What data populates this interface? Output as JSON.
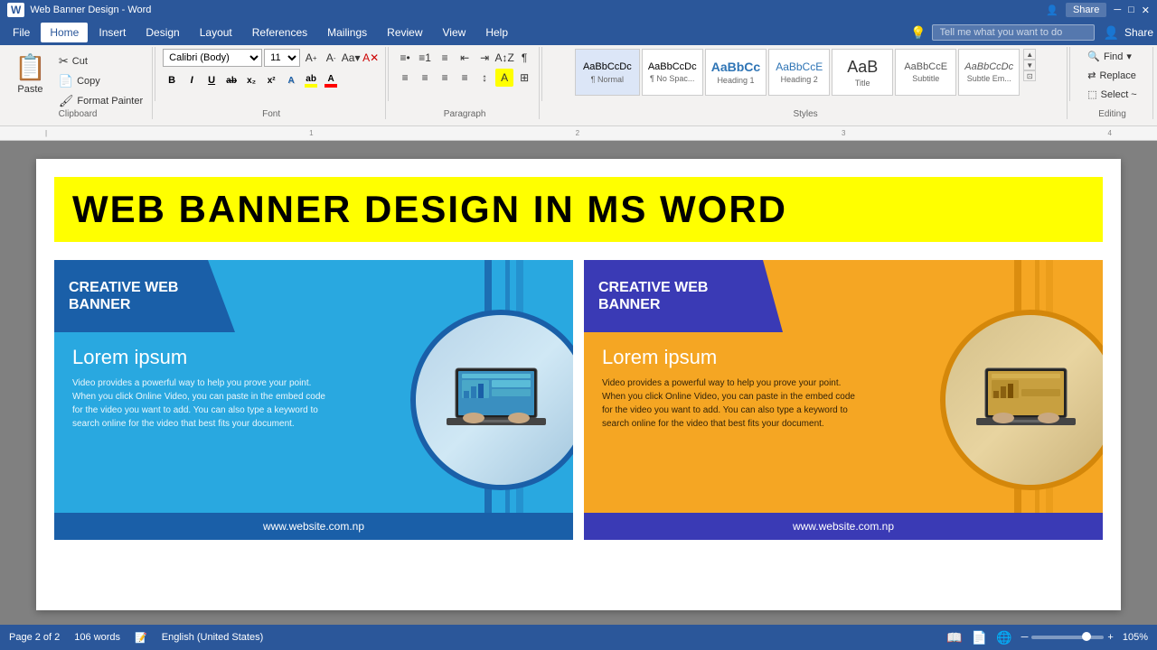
{
  "titlebar": {
    "doc_name": "Web Banner Design - Word",
    "share_label": "Share"
  },
  "menu": {
    "items": [
      "File",
      "Home",
      "Insert",
      "Design",
      "Layout",
      "References",
      "Mailings",
      "Review",
      "View",
      "Help"
    ],
    "active": "Home",
    "search_placeholder": "Tell me what you want to do"
  },
  "ribbon": {
    "clipboard": {
      "paste_label": "Paste",
      "cut_label": "Cut",
      "copy_label": "Copy",
      "format_painter_label": "Format Painter"
    },
    "font": {
      "font_name": "Calibri (Body)",
      "font_size": "11",
      "bold": "B",
      "italic": "I",
      "underline": "U",
      "strikethrough": "ab",
      "subscript": "x₂",
      "superscript": "x²"
    },
    "paragraph": {
      "label": "Paragraph"
    },
    "styles": {
      "label": "Styles",
      "items": [
        {
          "preview": "AaBbCcDc",
          "label": "¶ Normal"
        },
        {
          "preview": "AaBbCcDc",
          "label": "¶ No Spac..."
        },
        {
          "preview": "AaBbCc",
          "label": "Heading 1"
        },
        {
          "preview": "AaBbCcE",
          "label": "Heading 2"
        },
        {
          "preview": "AaB",
          "label": "Title"
        },
        {
          "preview": "AaBbCcE",
          "label": "Subtitle"
        },
        {
          "preview": "AaBbCcDc",
          "label": "Subtle Em..."
        }
      ]
    },
    "editing": {
      "label": "Editing",
      "find_label": "Find",
      "replace_label": "Replace",
      "select_label": "Select ~"
    }
  },
  "document": {
    "banner_heading": "WEB BANNER DESIGN IN MS WORD",
    "banner_left": {
      "title_line1": "CREATIVE WEB",
      "title_line2": "BANNER",
      "lorem_title": "Lorem ipsum",
      "lorem_body": "Video provides a powerful way to help you prove your point. When you click Online Video, you can paste in the embed code for the video you want to add. You can also type a keyword to search online for the video that best fits your document.",
      "website": "www.website.com.np"
    },
    "banner_right": {
      "title_line1": "CREATIVE WEB",
      "title_line2": "BANNER",
      "lorem_title": "Lorem ipsum",
      "lorem_body": "Video provides a powerful way to help you prove your point. When you click Online Video, you can paste in the embed code for the video you want to add. You can also type a keyword to search online for the video that best fits your document.",
      "website": "www.website.com.np"
    }
  },
  "statusbar": {
    "page_info": "Page 2 of 2",
    "word_count": "106 words",
    "language": "English (United States)",
    "zoom_level": "105%"
  }
}
